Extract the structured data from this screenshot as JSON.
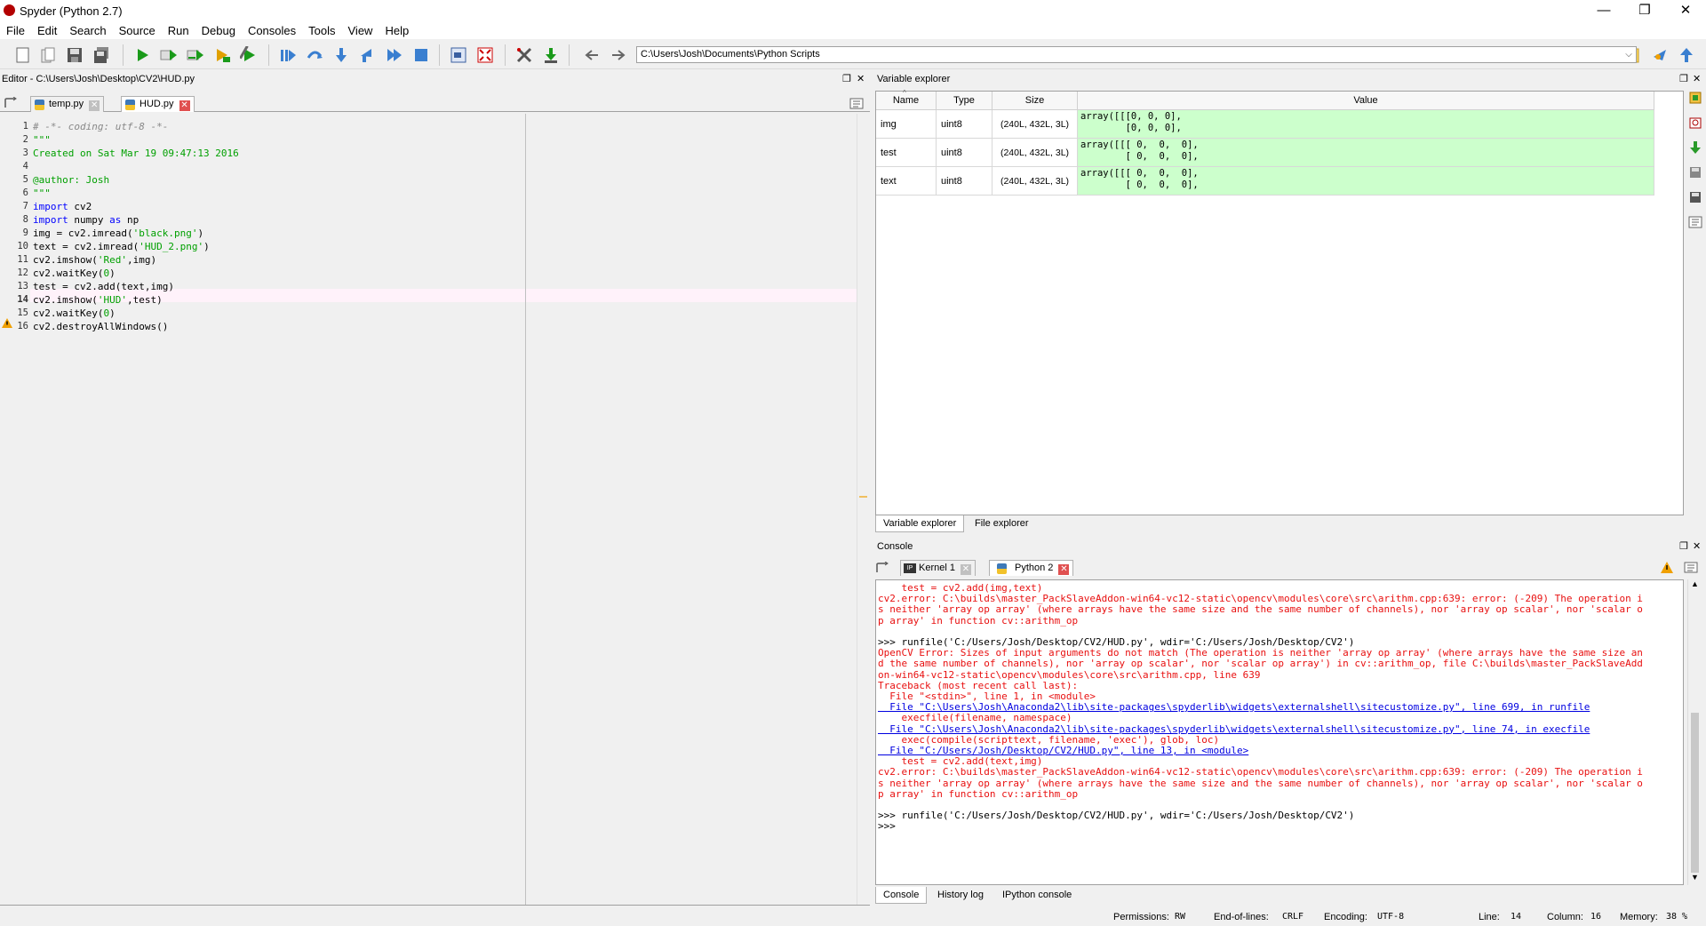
{
  "window": {
    "title": "Spyder (Python 2.7)"
  },
  "menu": [
    "File",
    "Edit",
    "Search",
    "Source",
    "Run",
    "Debug",
    "Consoles",
    "Tools",
    "View",
    "Help"
  ],
  "toolbar": {
    "path": "C:\\Users\\Josh\\Documents\\Python Scripts"
  },
  "editor": {
    "title": "Editor - C:\\Users\\Josh\\Desktop\\CV2\\HUD.py",
    "tabs": [
      {
        "label": "temp.py"
      },
      {
        "label": "HUD.py"
      }
    ],
    "lines": [
      "# -*- coding: utf-8 -*-",
      "\"\"\"",
      "Created on Sat Mar 19 09:47:13 2016",
      "",
      "@author: Josh",
      "\"\"\"",
      "import cv2",
      "import numpy as np",
      "img = cv2.imread('black.png')",
      "text = cv2.imread('HUD_2.png')",
      "cv2.imshow('Red',img)",
      "cv2.waitKey(0)",
      "test = cv2.add(text,img)",
      "cv2.imshow('HUD',test)",
      "cv2.waitKey(0)",
      "cv2.destroyAllWindows()"
    ],
    "current_line": 14
  },
  "variable_explorer": {
    "title": "Variable explorer",
    "columns": [
      "Name",
      "Type",
      "Size",
      "Value"
    ],
    "rows": [
      {
        "name": "img",
        "type": "uint8",
        "size": "(240L, 432L, 3L)",
        "value": "array([[[0, 0, 0],\n        [0, 0, 0],"
      },
      {
        "name": "test",
        "type": "uint8",
        "size": "(240L, 432L, 3L)",
        "value": "array([[[ 0,  0,  0],\n        [ 0,  0,  0],"
      },
      {
        "name": "text",
        "type": "uint8",
        "size": "(240L, 432L, 3L)",
        "value": "array([[[ 0,  0,  0],\n        [ 0,  0,  0],"
      }
    ],
    "bottom_tabs": [
      "Variable explorer",
      "File explorer"
    ]
  },
  "console": {
    "title": "Console",
    "tabs": [
      {
        "label": "Kernel 1"
      },
      {
        "label": "Python 2"
      }
    ],
    "lines": [
      {
        "text": "    test = cv2.add(img,text)",
        "style": "red"
      },
      {
        "text": "cv2.error: C:\\builds\\master_PackSlaveAddon-win64-vc12-static\\opencv\\modules\\core\\src\\arithm.cpp:639: error: (-209) The operation i",
        "style": "red"
      },
      {
        "text": "s neither 'array op array' (where arrays have the same size and the same number of channels), nor 'array op scalar', nor 'scalar o",
        "style": "red"
      },
      {
        "text": "p array' in function cv::arithm_op",
        "style": "red"
      },
      {
        "text": "",
        "style": "blk"
      },
      {
        "text": ">>> runfile('C:/Users/Josh/Desktop/CV2/HUD.py', wdir='C:/Users/Josh/Desktop/CV2')",
        "style": "blk"
      },
      {
        "text": "OpenCV Error: Sizes of input arguments do not match (The operation is neither 'array op array' (where arrays have the same size an",
        "style": "red"
      },
      {
        "text": "d the same number of channels), nor 'array op scalar', nor 'scalar op array') in cv::arithm_op, file C:\\builds\\master_PackSlaveAdd",
        "style": "red"
      },
      {
        "text": "on-win64-vc12-static\\opencv\\modules\\core\\src\\arithm.cpp, line 639",
        "style": "red"
      },
      {
        "text": "Traceback (most recent call last):",
        "style": "red"
      },
      {
        "text": "  File \"<stdin>\", line 1, in <module>",
        "style": "red"
      },
      {
        "text": "  File \"C:\\Users\\Josh\\Anaconda2\\lib\\site-packages\\spyderlib\\widgets\\externalshell\\sitecustomize.py\", line 699, in runfile",
        "style": "lnk"
      },
      {
        "text": "    execfile(filename, namespace)",
        "style": "red"
      },
      {
        "text": "  File \"C:\\Users\\Josh\\Anaconda2\\lib\\site-packages\\spyderlib\\widgets\\externalshell\\sitecustomize.py\", line 74, in execfile",
        "style": "lnk"
      },
      {
        "text": "    exec(compile(scripttext, filename, 'exec'), glob, loc)",
        "style": "red"
      },
      {
        "text": "  File \"C:/Users/Josh/Desktop/CV2/HUD.py\", line 13, in <module>",
        "style": "lnk"
      },
      {
        "text": "    test = cv2.add(text,img)",
        "style": "red"
      },
      {
        "text": "cv2.error: C:\\builds\\master_PackSlaveAddon-win64-vc12-static\\opencv\\modules\\core\\src\\arithm.cpp:639: error: (-209) The operation i",
        "style": "red"
      },
      {
        "text": "s neither 'array op array' (where arrays have the same size and the same number of channels), nor 'array op scalar', nor 'scalar o",
        "style": "red"
      },
      {
        "text": "p array' in function cv::arithm_op",
        "style": "red"
      },
      {
        "text": "",
        "style": "blk"
      },
      {
        "text": ">>> runfile('C:/Users/Josh/Desktop/CV2/HUD.py', wdir='C:/Users/Josh/Desktop/CV2')",
        "style": "blk"
      },
      {
        "text": ">>> ",
        "style": "blk"
      }
    ],
    "bottom_tabs": [
      "Console",
      "History log",
      "IPython console"
    ]
  },
  "status": {
    "permissions_label": "Permissions:",
    "permissions": "RW",
    "eol_label": "End-of-lines:",
    "eol": "CRLF",
    "encoding_label": "Encoding:",
    "encoding": "UTF-8",
    "line_label": "Line:",
    "line": "14",
    "column_label": "Column:",
    "column": "16",
    "memory_label": "Memory:",
    "memory": "38 %"
  }
}
